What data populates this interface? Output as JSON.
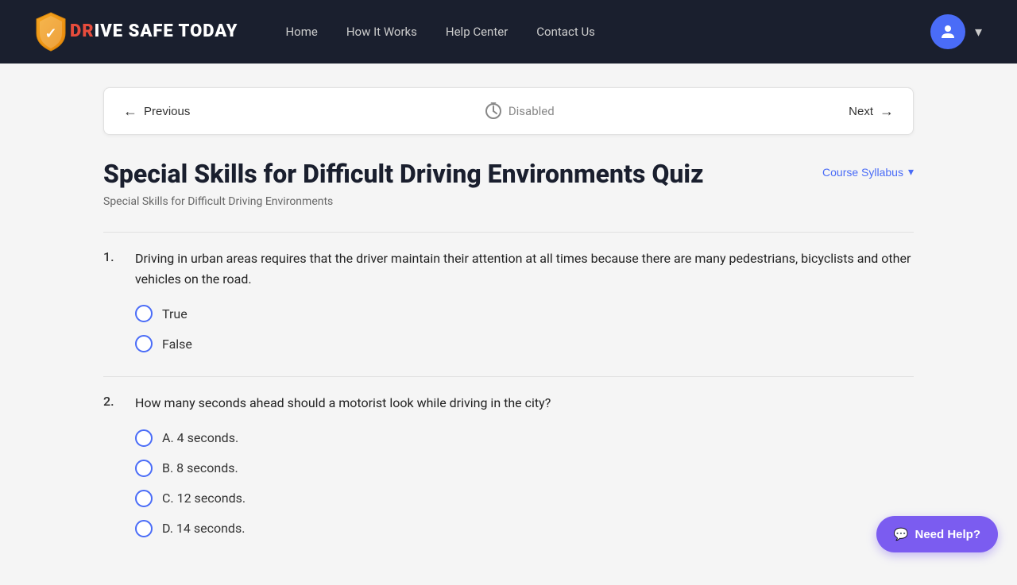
{
  "nav": {
    "logo_text_dr": "DR",
    "logo_text_ive": "IVE SAFE TODAY",
    "links": [
      {
        "label": "Home",
        "href": "#"
      },
      {
        "label": "How It Works",
        "href": "#"
      },
      {
        "label": "Help Center",
        "href": "#"
      },
      {
        "label": "Contact Us",
        "href": "#"
      }
    ]
  },
  "quiz_nav": {
    "previous_label": "Previous",
    "disabled_label": "Disabled",
    "next_label": "Next"
  },
  "quiz": {
    "title": "Special Skills for Difficult Driving Environments Quiz",
    "subtitle": "Special Skills for Difficult Driving Environments",
    "course_syllabus_label": "Course Syllabus"
  },
  "questions": [
    {
      "number": "1.",
      "text": "Driving in urban areas requires that the driver maintain their attention at all times because there are many pedestrians, bicyclists and other vehicles on the road.",
      "options": [
        {
          "label": "True"
        },
        {
          "label": "False"
        }
      ]
    },
    {
      "number": "2.",
      "text": "How many seconds ahead should a motorist look while driving in the city?",
      "options": [
        {
          "label": "A. 4 seconds."
        },
        {
          "label": "B. 8 seconds."
        },
        {
          "label": "C. 12 seconds."
        },
        {
          "label": "D. 14 seconds."
        }
      ]
    }
  ],
  "help_button": {
    "label": "Need Help?"
  }
}
